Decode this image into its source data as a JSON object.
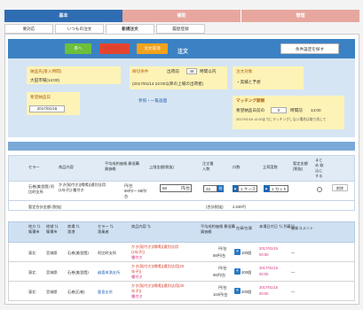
{
  "top_tabs": [
    "基本",
    "補助",
    "管理"
  ],
  "sub_tabs": [
    "要対応",
    "いつもの注文",
    "新規注文",
    "履歴登録"
  ],
  "order": {
    "btn_market": "単へ",
    "btn_history": "履歴画面へ",
    "btn_cancel": "注文取消",
    "title": "注文",
    "btn_condition": "条件設定を探す",
    "delivery_label": "納品先(受入時間)",
    "delivery_value": "大田市場(14:00)",
    "desired_label": "希望納品日",
    "desired_value": "2017/01/16",
    "deadline_label": "締切条件",
    "deadline_value": "出荷前",
    "deadline_hours": "48",
    "deadline_unit": "時間以内",
    "deadline_note": "(2017/01/14 22:00以降の上場の出荷者)",
    "deadline_link": "参照・一覧画面",
    "target_label": "注文対象",
    "target_value": "・実績と予想",
    "matching_label": "マッチング期限",
    "matching_text": "希望納品日前の",
    "matching_hours": "0",
    "matching_unit": "時間前",
    "matching_time": "14:00",
    "matching_note": "2017/01/16 12:00までにマッチングしない場合は取り消して"
  },
  "cart": {
    "headers": [
      "セラー",
      "商品内容",
      "平均成約価格 最低購買価格",
      "上限金額(税抜)",
      "注文量 入数",
      "口数",
      "立荷度数",
      "暫定金額 (税抜)",
      "まとめ 取込にする"
    ],
    "row": {
      "seller": "石巻(美里園) 阿比町支所",
      "product": "かき(殻付き)(鳴鳴)(通別法用(1年子)) 種付き",
      "avg_price": "円/台",
      "min_price": "88円/一 88円/台",
      "limit_price": "88",
      "limit_unit": "円/台",
      "qty": "32",
      "qty_unit": "個",
      "count": "1",
      "count_unit": "ケース",
      "shipping": "1",
      "shipping_unit": "カット",
      "delete": "削除"
    },
    "sum_label": "暫定合計金額 (税抜)",
    "sum_total_label": "(合計税抜)",
    "sum_total_value": "2,640円"
  },
  "list": {
    "headers": [
      "地方 ⇅ 集積市",
      "地域 ⇅ 集積市",
      "商場 ⇅ 漁港",
      "セラー ⇅ 漁業者",
      "商品内容 ⇅",
      "平均成約価格 最低購買価格",
      "在庫/在庫",
      "本場日付日 ⇅ 到着日",
      "最新コメント"
    ],
    "rows": [
      {
        "area": "東北",
        "region": "宮城県",
        "market": "石巻(美里園)",
        "seller": "阿比町支所",
        "product_a": "かき(殻付き)(鳴鳴)(通別法用",
        "product_b": "(1年子))",
        "product_c": "種付き",
        "avg": "円/台",
        "min": "88円/台",
        "stock": "100個",
        "date": "2017/01/15",
        "time": "00:00",
        "comment": "—"
      },
      {
        "area": "東北",
        "region": "宮城県",
        "market": "石巻(美里園)",
        "seller": "越喜来漁支所",
        "product_a": "かき(殻付き)(鳴鳴)(通別法用(20",
        "product_b": "年子))",
        "product_c": "種付き",
        "avg": "円/台",
        "min": "96円/台",
        "stock": "400個",
        "date": "2017/01/15",
        "time": "00:00",
        "comment": "—"
      },
      {
        "area": "東北",
        "region": "宮城県",
        "market": "石巻(石巻)",
        "seller": "鹿島支所",
        "product_a": "かき(殻付き)(鳴鳴)(通別法用(30",
        "product_b": "年子))",
        "product_c": "種付き",
        "avg": "円/台",
        "min": "104円/台",
        "stock": "200個",
        "date": "2017/01/15",
        "time": "00:00",
        "comment": "—"
      }
    ]
  }
}
